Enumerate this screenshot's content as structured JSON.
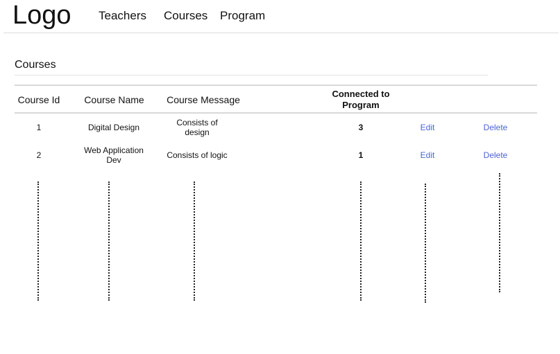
{
  "header": {
    "logo": "Logo",
    "nav": [
      {
        "label": "Teachers"
      },
      {
        "label": "Courses"
      },
      {
        "label": "Program"
      }
    ]
  },
  "main": {
    "section_title": "Courses",
    "table": {
      "columns": [
        "Course Id",
        "Course Name",
        "Course Message",
        "Connected to Program"
      ],
      "rows": [
        {
          "id": "1",
          "name": "Digital Design",
          "message": "Consists of design",
          "connected": "3",
          "edit_label": "Edit",
          "delete_label": "Delete"
        },
        {
          "id": "2",
          "name": "Web Application Dev",
          "message": "Consists of logic",
          "connected": "1",
          "edit_label": "Edit",
          "delete_label": "Delete"
        }
      ]
    }
  },
  "colors": {
    "link": "#4a64d6",
    "divider": "#d8d8d8",
    "text": "#111111"
  }
}
